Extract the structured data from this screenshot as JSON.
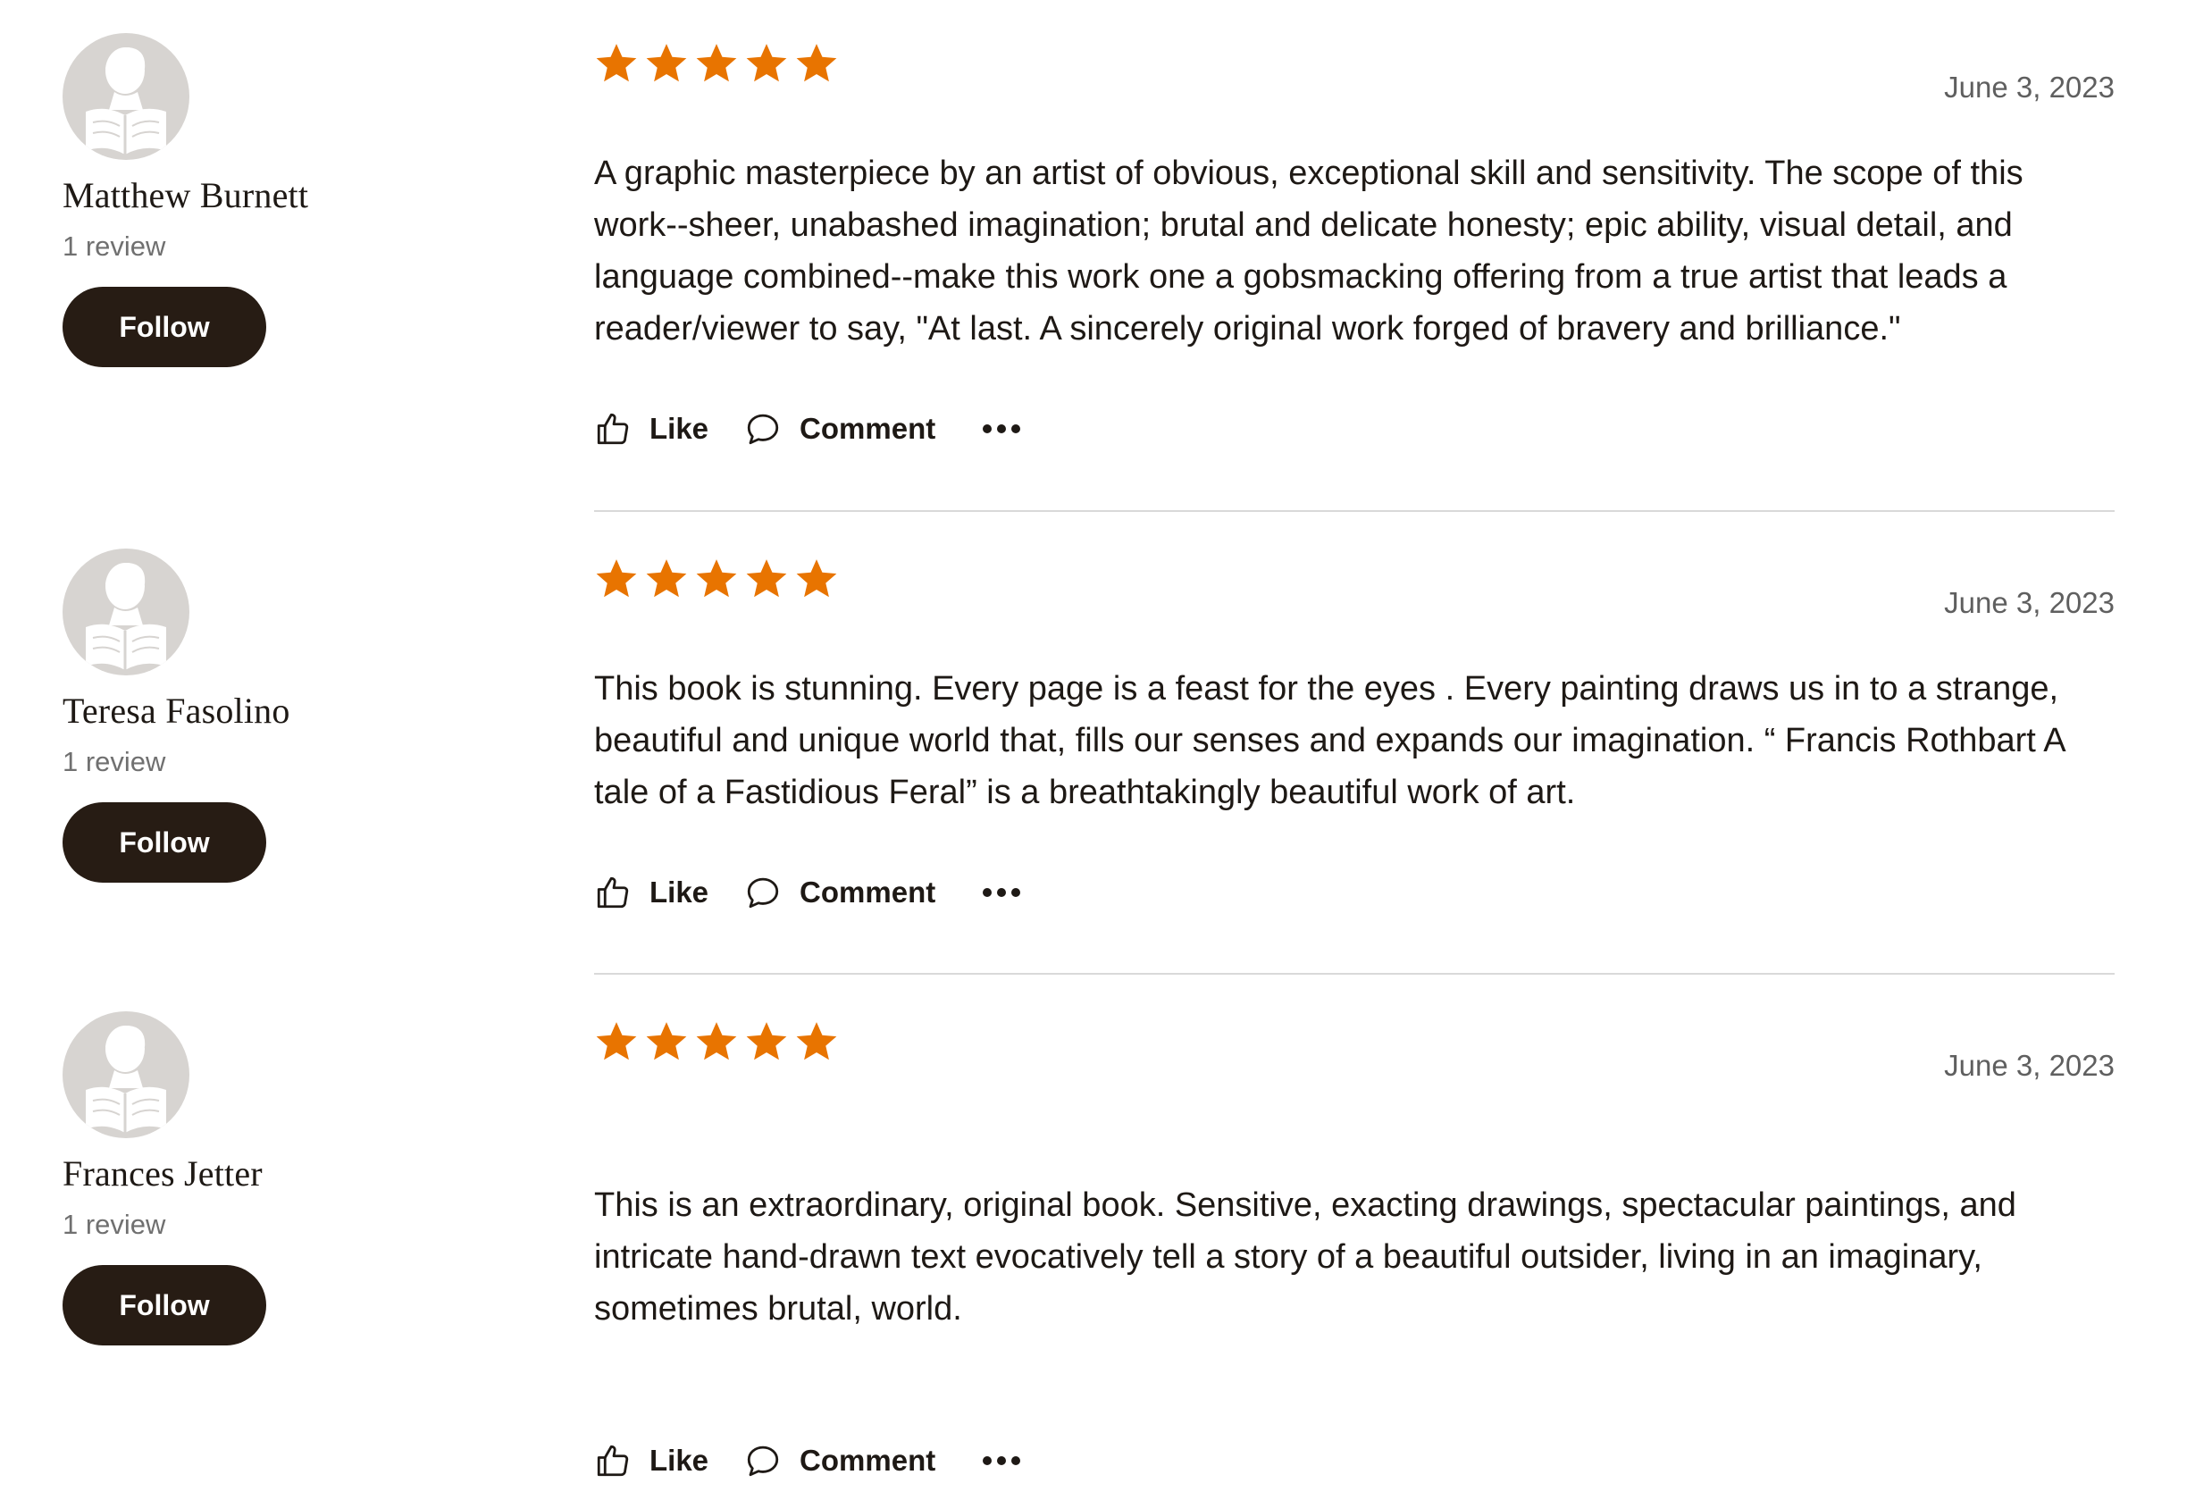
{
  "colors": {
    "star": "#e87400",
    "follow_button_bg": "#271c14",
    "avatar_bg": "#d7d4d1",
    "divider": "#d9d9d9"
  },
  "reviews": [
    {
      "reviewer_name": "Matthew Burnett",
      "review_count": "1 review",
      "follow_label": "Follow",
      "rating": 5,
      "date": "June 3, 2023",
      "text": "A graphic masterpiece by an artist of obvious, exceptional skill and sensitivity. The scope of this work--sheer, unabashed imagination; brutal and delicate honesty; epic ability, visual detail, and language combined--make this work one a gobsmacking offering from a true artist that leads a reader/viewer to say, \"At last. A sincerely original work forged of bravery and brilliance.\"",
      "like_label": "Like",
      "comment_label": "Comment",
      "more_icon": "more-options-icon"
    },
    {
      "reviewer_name": "Teresa Fasolino",
      "review_count": "1 review",
      "follow_label": "Follow",
      "rating": 5,
      "date": "June 3, 2023",
      "text": "This book is stunning. Every page is a feast for the eyes . Every painting draws us in to a strange, beautiful and unique world that, fills our senses and expands our imagination. “ Francis Rothbart A tale of a Fastidious Feral” is a breathtakingly beautiful work of art.",
      "like_label": "Like",
      "comment_label": "Comment",
      "more_icon": "more-options-icon"
    },
    {
      "reviewer_name": "Frances Jetter",
      "review_count": "1 review",
      "follow_label": "Follow",
      "rating": 5,
      "date": "June 3, 2023",
      "text": "This is an extraordinary, original book. Sensitive, exacting drawings, spectacular paintings, and intricate hand-drawn text evocatively tell a story of a beautiful outsider, living in an imaginary, sometimes brutal, world.",
      "like_label": "Like",
      "comment_label": "Comment",
      "more_icon": "more-options-icon"
    }
  ]
}
